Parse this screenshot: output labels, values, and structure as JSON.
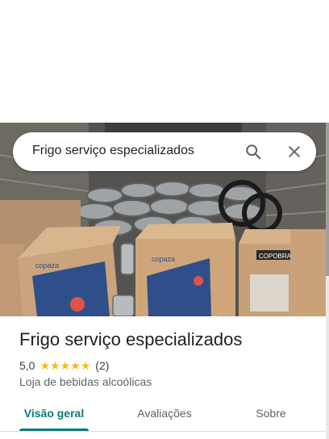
{
  "search": {
    "query": "Frigo serviço especializados"
  },
  "place": {
    "name": "Frigo serviço especializados",
    "rating": "5,0",
    "stars": 5,
    "review_count": "(2)",
    "category": "Loja de bebidas alcoólicas"
  },
  "hero": {
    "box_logo_1": "copaza",
    "box_logo_2": "copaza",
    "box_logo_3": "COPOBRAS"
  },
  "tabs": [
    {
      "label": "Visão geral",
      "active": true
    },
    {
      "label": "Avaliações",
      "active": false
    },
    {
      "label": "Sobre",
      "active": false
    }
  ],
  "colors": {
    "accent": "#0b7a7a",
    "star": "#fbbc04"
  }
}
